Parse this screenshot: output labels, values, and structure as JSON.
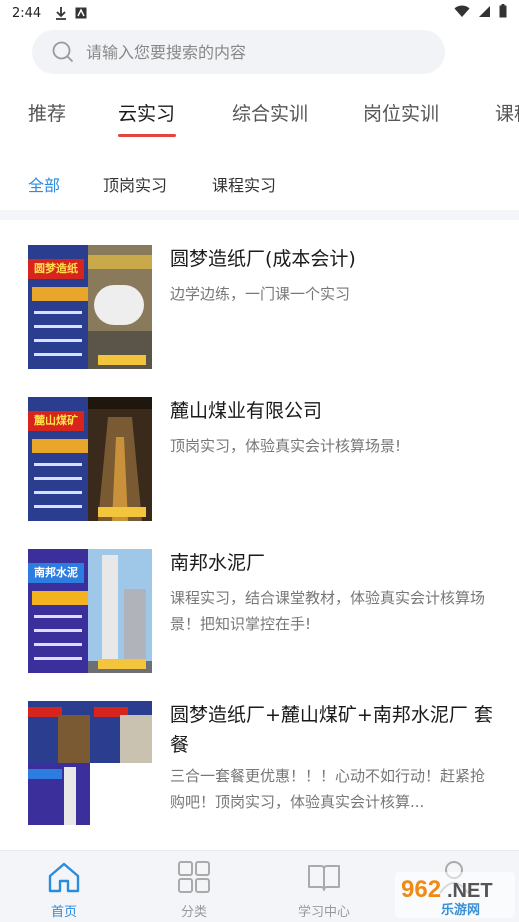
{
  "status_bar": {
    "time": "2:44"
  },
  "search": {
    "placeholder": "请输入您要搜索的内容"
  },
  "tabs": [
    {
      "label": "推荐"
    },
    {
      "label": "云实习"
    },
    {
      "label": "综合实训"
    },
    {
      "label": "岗位实训"
    },
    {
      "label": "课程"
    }
  ],
  "subtabs": [
    {
      "label": "全部"
    },
    {
      "label": "顶岗实习"
    },
    {
      "label": "课程实习"
    }
  ],
  "items": [
    {
      "title": "圆梦造纸厂(成本会计)",
      "desc": "边学边练，一门课一个实习",
      "thumb_banner": "圆梦造纸"
    },
    {
      "title": "麓山煤业有限公司",
      "desc": "顶岗实习，体验真实会计核算场景!",
      "thumb_banner": "麓山煤矿"
    },
    {
      "title": "南邦水泥厂",
      "desc": "课程实习，结合课堂教材，体验真实会计核算场景！把知识掌控在手!",
      "thumb_banner": "南邦水泥"
    },
    {
      "title": "圆梦造纸厂+麓山煤矿+南邦水泥厂 套餐",
      "desc": "三合一套餐更优惠！！！心动不如行动！赶紧抢购吧！顶岗实习，体验真实会计核算...",
      "thumb_banner": ""
    }
  ],
  "bottom_nav": [
    {
      "label": "首页",
      "icon": "home-icon"
    },
    {
      "label": "分类",
      "icon": "grid-icon"
    },
    {
      "label": "学习中心",
      "icon": "book-icon"
    },
    {
      "label": "",
      "icon": "user-icon"
    }
  ],
  "watermark": {
    "text": "962.NET",
    "sub": "乐游网"
  },
  "colors": {
    "accent": "#2a8cde",
    "tab_underline": "#e2453c"
  }
}
